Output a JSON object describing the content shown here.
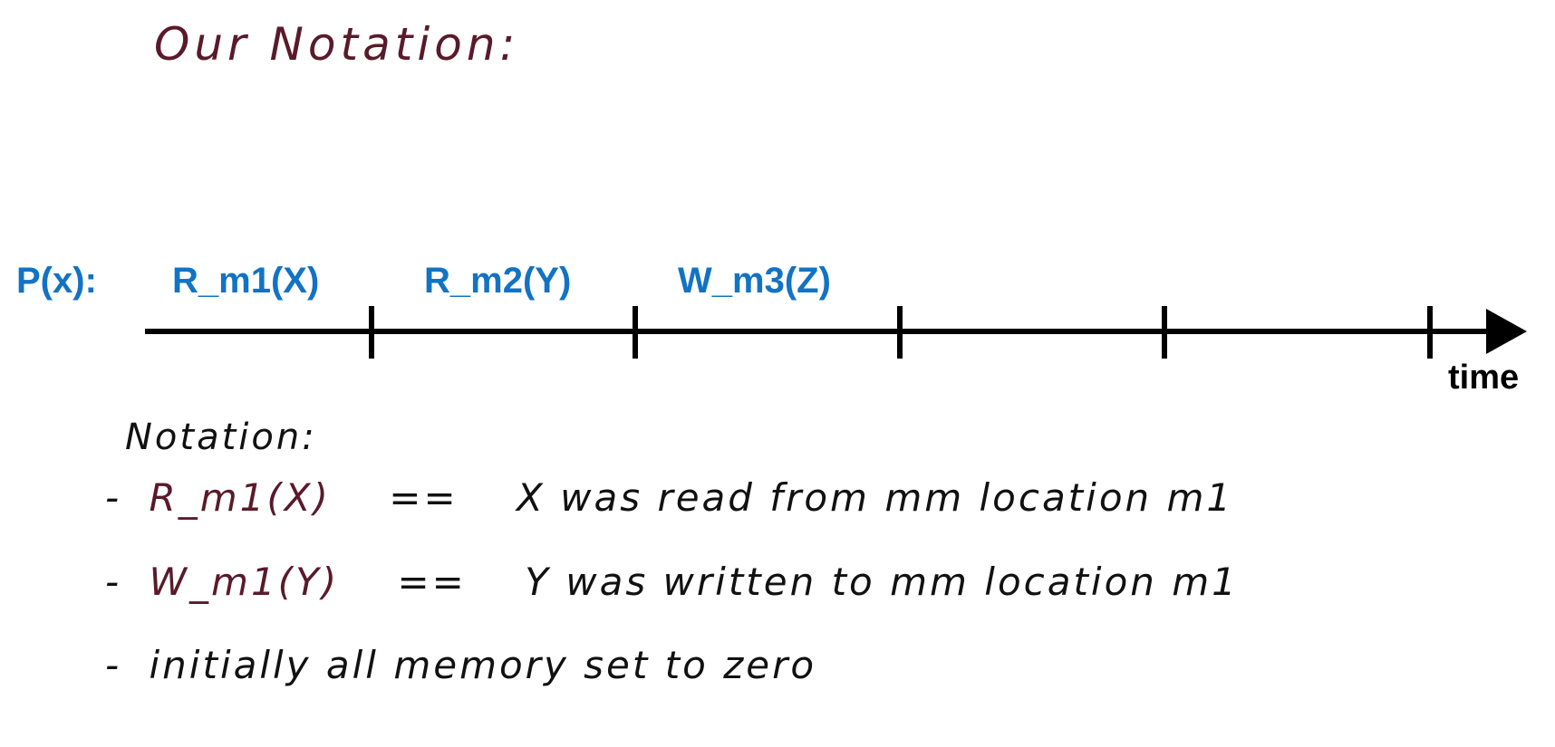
{
  "title": "Our Notation:",
  "timeline": {
    "process_label": "P(x):",
    "events": [
      {
        "label": "R_m1(X)"
      },
      {
        "label": "R_m2(Y)"
      },
      {
        "label": "W_m3(Z)"
      }
    ],
    "axis_label": "time"
  },
  "notes": {
    "heading": "Notation:",
    "items": [
      {
        "bullet": "-",
        "term": "R_m1(X)",
        "operator": "==",
        "text": "X was read from mm location m1"
      },
      {
        "bullet": "-",
        "term": "W_m1(Y)",
        "operator": "==",
        "text": "Y was written to mm location m1"
      },
      {
        "bullet": "-",
        "term": "",
        "operator": "",
        "text": "initially all memory set to zero"
      }
    ]
  },
  "colors": {
    "title": "#5a1a2a",
    "term": "#5a1a2a",
    "timeline_labels": "#1273c4",
    "axis": "#000000"
  }
}
